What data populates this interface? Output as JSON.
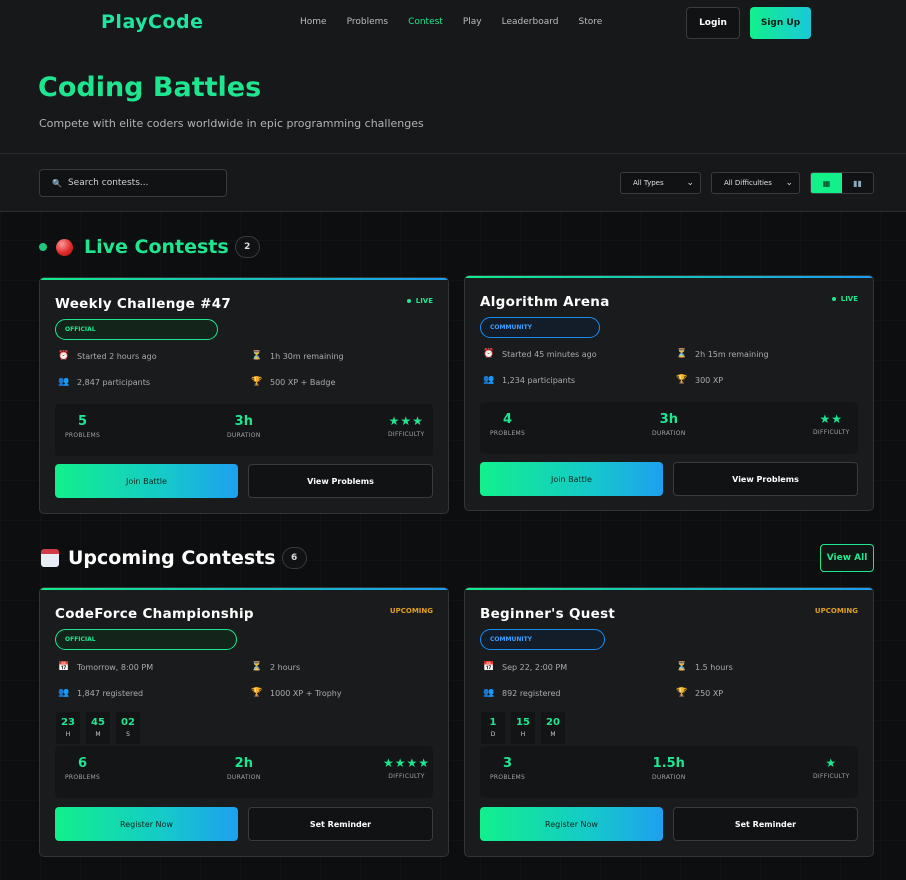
{
  "nav": {
    "logo": "PlayCode",
    "links": [
      "Home",
      "Problems",
      "Contest",
      "Play",
      "Leaderboard",
      "Store"
    ],
    "active": "Contest",
    "login": "Login",
    "signup": "Sign Up"
  },
  "hero": {
    "title": "Coding Battles",
    "subtitle": "Compete with elite coders worldwide in epic programming challenges"
  },
  "filters": {
    "search_placeholder": "Search contests...",
    "types": "All Types",
    "difficulties": "All Difficulties",
    "view_grid_icon": "grid-icon",
    "view_chart_icon": "chart-icon"
  },
  "live": {
    "title": "Live Contests",
    "count": "2",
    "cards": [
      {
        "title": "Weekly Challenge #47",
        "status": "LIVE",
        "tag": "OFFICIAL",
        "started": "Started 2 hours ago",
        "remaining": "1h 30m remaining",
        "participants": "2,847 participants",
        "reward": "500 XP + Badge",
        "problems": "5",
        "problems_label": "PROBLEMS",
        "duration": "3h",
        "duration_label": "DURATION",
        "difficulty": "★★★",
        "difficulty_label": "DIFFICULTY",
        "primary": "Join Battle",
        "secondary": "View Problems"
      },
      {
        "title": "Algorithm Arena",
        "status": "LIVE",
        "tag": "COMMUNITY",
        "started": "Started 45 minutes ago",
        "remaining": "2h 15m remaining",
        "participants": "1,234 participants",
        "reward": "300 XP",
        "problems": "4",
        "problems_label": "PROBLEMS",
        "duration": "3h",
        "duration_label": "DURATION",
        "difficulty": "★★",
        "difficulty_label": "DIFFICULTY",
        "primary": "Join Battle",
        "secondary": "View Problems"
      }
    ]
  },
  "upcoming": {
    "title": "Upcoming Contests",
    "count": "6",
    "view_all": "View All",
    "cards": [
      {
        "title": "CodeForce Championship",
        "status": "UPCOMING",
        "tag": "OFFICIAL",
        "date": "Tomorrow, 8:00 PM",
        "length": "2 hours",
        "registered": "1,847 registered",
        "reward": "1000 XP + Trophy",
        "countdown": [
          {
            "v": "23",
            "u": "H"
          },
          {
            "v": "45",
            "u": "M"
          },
          {
            "v": "02",
            "u": "S"
          }
        ],
        "problems": "6",
        "problems_label": "PROBLEMS",
        "duration": "2h",
        "duration_label": "DURATION",
        "difficulty": "★★★★",
        "difficulty_label": "DIFFICULTY",
        "primary": "Register Now",
        "secondary": "Set Reminder"
      },
      {
        "title": "Beginner's Quest",
        "status": "UPCOMING",
        "tag": "COMMUNITY",
        "date": "Sep 22, 2:00 PM",
        "length": "1.5 hours",
        "registered": "892 registered",
        "reward": "250 XP",
        "countdown": [
          {
            "v": "1",
            "u": "D"
          },
          {
            "v": "15",
            "u": "H"
          },
          {
            "v": "20",
            "u": "M"
          }
        ],
        "problems": "3",
        "problems_label": "PROBLEMS",
        "duration": "1.5h",
        "duration_label": "DURATION",
        "difficulty": "★",
        "difficulty_label": "DIFFICULTY",
        "primary": "Register Now",
        "secondary": "Set Reminder"
      }
    ]
  }
}
